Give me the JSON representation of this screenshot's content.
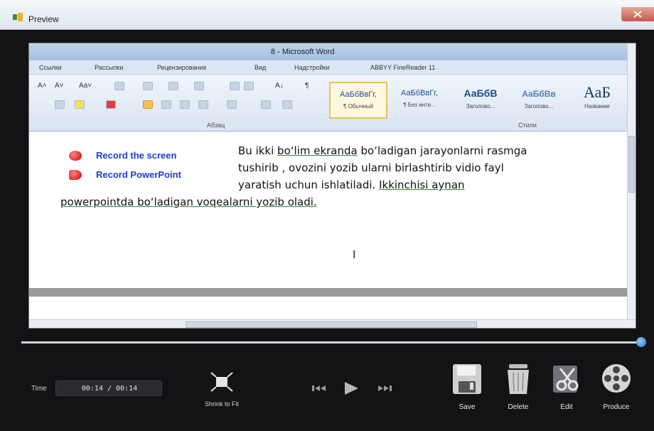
{
  "window": {
    "title": "Preview"
  },
  "word": {
    "title": "8 - Microsoft Word",
    "tabs": [
      "Ссылки",
      "Рассылки",
      "Рецензирование",
      "Вид",
      "Надстройки",
      "ABBYY FineReader 11"
    ],
    "group_labels": {
      "paragraph": "Абзац",
      "styles": "Стили"
    },
    "styles": [
      {
        "sample": "АаБбВвГг,",
        "name": "¶ Обычный"
      },
      {
        "sample": "АаБбВвГг,",
        "name": "¶ Без инте..."
      },
      {
        "sample": "АаБбВ",
        "name": "Заголово..."
      },
      {
        "sample": "АаБбВв",
        "name": "Заголово..."
      },
      {
        "sample": "АаБ",
        "name": "Название"
      }
    ],
    "toolbar_glyphs": {
      "grow_font": "A˄",
      "shrink_font": "A˅",
      "change_case": "Aa˅",
      "pilcrow": "¶",
      "sort": "A↓"
    }
  },
  "document": {
    "record_screen": "Record the screen",
    "record_powerpoint": "Record PowerPoint",
    "para": {
      "l1_a": "Bu ikki ",
      "l1_b": "bo‘lim  ekranda",
      "l1_c": " bo‘ladigan jarayonlarni rasmga",
      "l2": "tushirib , ovozini yozib ularni birlashtirib vidio fayl",
      "l3_a": "yaratish uchun ishlatiladi. ",
      "l3_b": "Ikkinchisi aynan ",
      "l4": "powerpointda bo‘ladigan voqealarni yozib oladi."
    },
    "cursor": "I"
  },
  "player": {
    "time_label": "Time",
    "time_value": "00:14 / 00:14",
    "progress": 1.0,
    "shrink_label": "Shrink to Fit",
    "actions": {
      "save": "Save",
      "delete": "Delete",
      "edit": "Edit",
      "produce": "Produce"
    }
  },
  "colors": {
    "record_blue": "#1a3fd1",
    "record_red": "#d40000",
    "underline_green": "#2e8b2e",
    "seek_blue": "#2a74c8"
  }
}
